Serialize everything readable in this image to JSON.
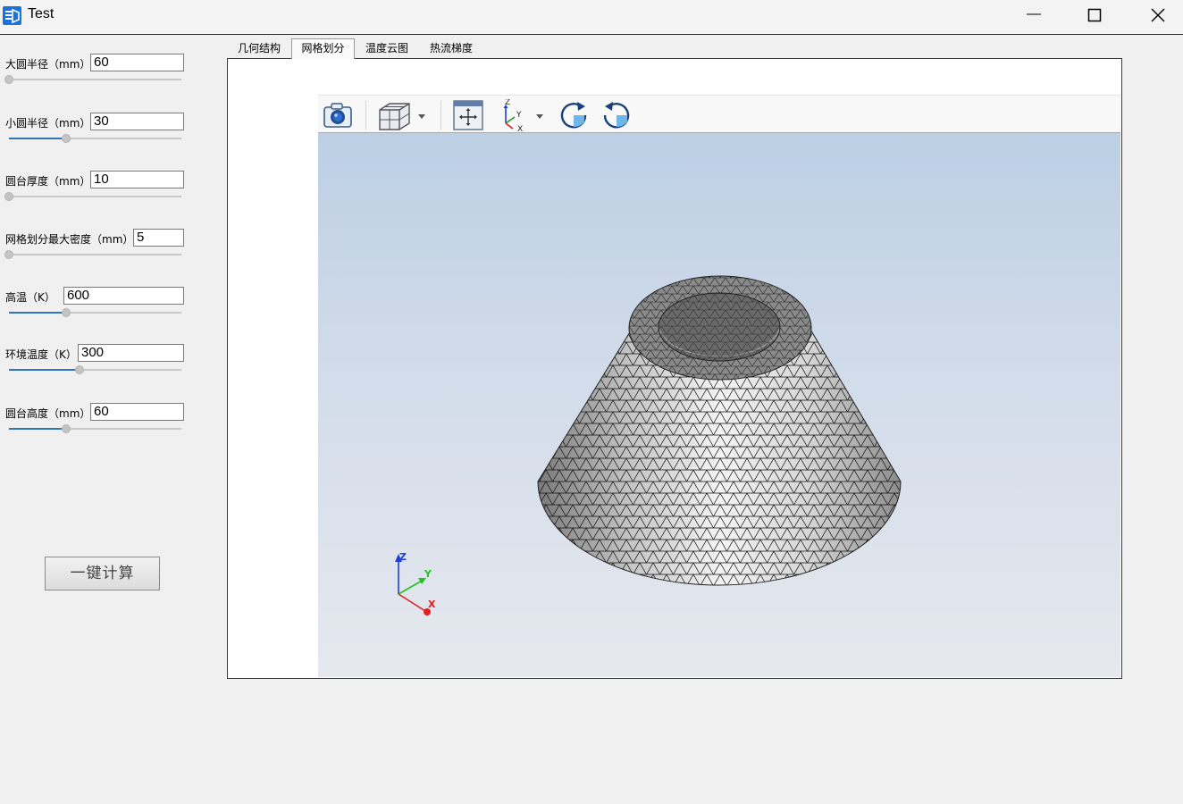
{
  "window": {
    "title": "Test"
  },
  "params": [
    {
      "label": "大圆半径（mm）",
      "value": "60",
      "slider_fraction": 0.0
    },
    {
      "label": "小圆半径（mm）",
      "value": "30",
      "slider_fraction": 0.33
    },
    {
      "label": "圆台厚度（mm）",
      "value": "10",
      "slider_fraction": 0.0
    },
    {
      "label": "网格划分最大密度（mm）",
      "value": "5",
      "slider_fraction": 0.0
    },
    {
      "label": "高温（K）",
      "value": "600",
      "slider_fraction": 0.33
    },
    {
      "label": "环境温度（K）",
      "value": "300",
      "slider_fraction": 0.41
    },
    {
      "label": "圆台高度（mm）",
      "value": "60",
      "slider_fraction": 0.33
    }
  ],
  "calc_button": "一键计算",
  "tabs": [
    "几何结构",
    "网格划分",
    "温度云图",
    "热流梯度"
  ],
  "active_tab": "网格划分",
  "toolbar": [
    "camera-icon",
    "view-cube-icon",
    "fit-all-icon",
    "axes-icon",
    "rotate-cw-icon",
    "rotate-ccw-icon"
  ],
  "triad": {
    "x": "X",
    "y": "Y",
    "z": "Z"
  },
  "colors": {
    "slider_fill": "#3173b7",
    "triad_x": "#e02020",
    "triad_y": "#22c422",
    "triad_z": "#1f3fd8"
  }
}
